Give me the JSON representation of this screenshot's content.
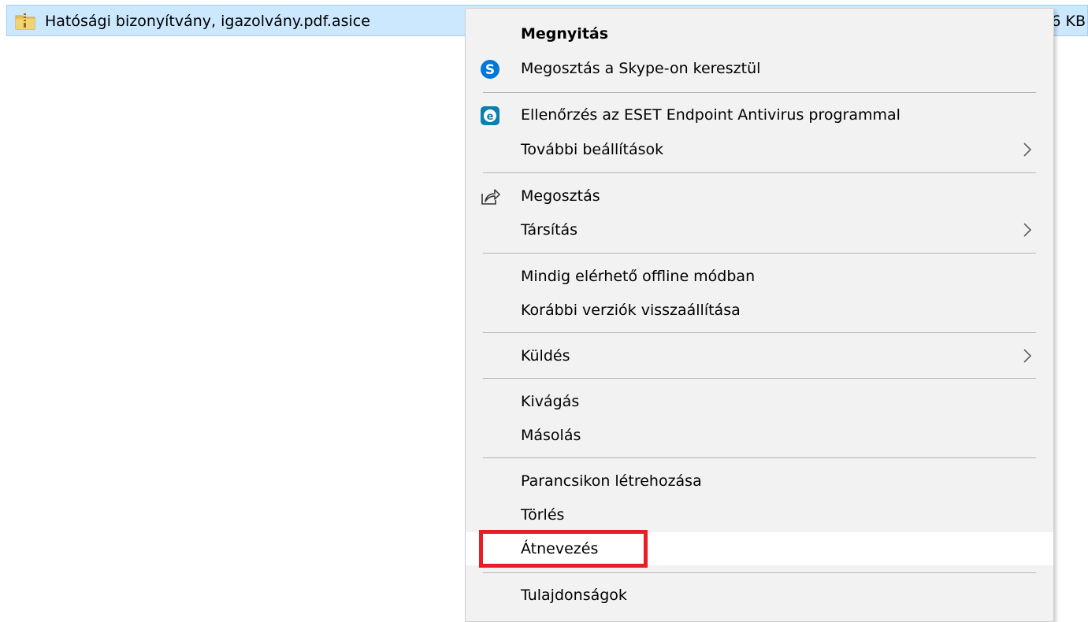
{
  "file": {
    "name": "Hatósági bizonyítvány, igazolvány.pdf.asice",
    "size": "6 KB",
    "icon": "zip-folder-icon"
  },
  "colors": {
    "selection_bg": "#cce8ff",
    "menu_bg": "#f2f2f2",
    "hover_bg": "#ffffff",
    "highlight_border": "#ea1c24",
    "skype_blue": "#0078d7",
    "eset_blue": "#0a7fb0"
  },
  "menu": {
    "open": "Megnyitás",
    "share_skype": "Megosztás a Skype-on keresztül",
    "eset_scan": "Ellenőrzés az ESET Endpoint Antivirus programmal",
    "more_settings": "További beállítások",
    "share": "Megosztás",
    "open_with": "Társítás",
    "offline": "Mindig elérhető offline módban",
    "restore_versions": "Korábbi verziók visszaállítása",
    "send_to": "Küldés",
    "cut": "Kivágás",
    "copy": "Másolás",
    "create_shortcut": "Parancsikon létrehozása",
    "delete": "Törlés",
    "rename": "Átnevezés",
    "properties": "Tulajdonságok"
  },
  "highlighted_item": "rename"
}
